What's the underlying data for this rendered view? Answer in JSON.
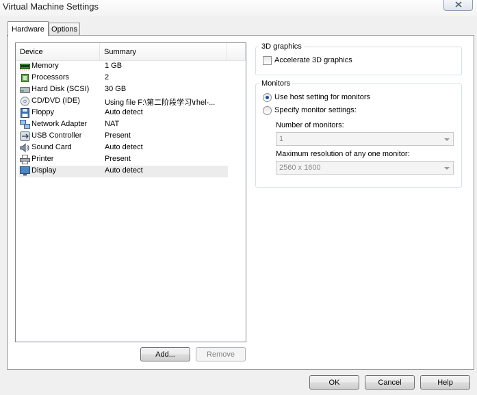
{
  "window": {
    "title": "Virtual Machine Settings"
  },
  "tabs": [
    {
      "label": "Hardware",
      "active": true
    },
    {
      "label": "Options",
      "active": false
    }
  ],
  "device_list": {
    "columns": [
      "Device",
      "Summary"
    ],
    "rows": [
      {
        "device": "Memory",
        "summary": "1 GB",
        "icon": "memory-icon"
      },
      {
        "device": "Processors",
        "summary": "2",
        "icon": "processor-icon"
      },
      {
        "device": "Hard Disk (SCSI)",
        "summary": "30 GB",
        "icon": "hard-disk-icon"
      },
      {
        "device": "CD/DVD (IDE)",
        "summary": "Using file F:\\第二阶段学习\\rhel-...",
        "icon": "cd-dvd-icon"
      },
      {
        "device": "Floppy",
        "summary": "Auto detect",
        "icon": "floppy-icon"
      },
      {
        "device": "Network Adapter",
        "summary": "NAT",
        "icon": "network-adapter-icon"
      },
      {
        "device": "USB Controller",
        "summary": "Present",
        "icon": "usb-icon"
      },
      {
        "device": "Sound Card",
        "summary": "Auto detect",
        "icon": "speaker-icon"
      },
      {
        "device": "Printer",
        "summary": "Present",
        "icon": "printer-icon"
      },
      {
        "device": "Display",
        "summary": "Auto detect",
        "icon": "display-icon",
        "selected": true
      }
    ],
    "add_label": "Add...",
    "remove_label": "Remove"
  },
  "graphics_3d": {
    "group_label": "3D graphics",
    "accelerate_label": "Accelerate 3D graphics",
    "accelerate_checked": false
  },
  "monitors": {
    "group_label": "Monitors",
    "use_host_label": "Use host setting for monitors",
    "specify_label": "Specify monitor settings:",
    "selected_option": "Use host setting for monitors",
    "number_label": "Number of monitors:",
    "number_value": "1",
    "max_res_label": "Maximum resolution of any one monitor:",
    "max_res_value": "2560 x 1600"
  },
  "footer": {
    "ok_label": "OK",
    "cancel_label": "Cancel",
    "help_label": "Help"
  },
  "colors": {
    "selected_row": "#ececec",
    "window_bg": "#f0f0f0",
    "radio_dot": "#1f4f8e"
  }
}
